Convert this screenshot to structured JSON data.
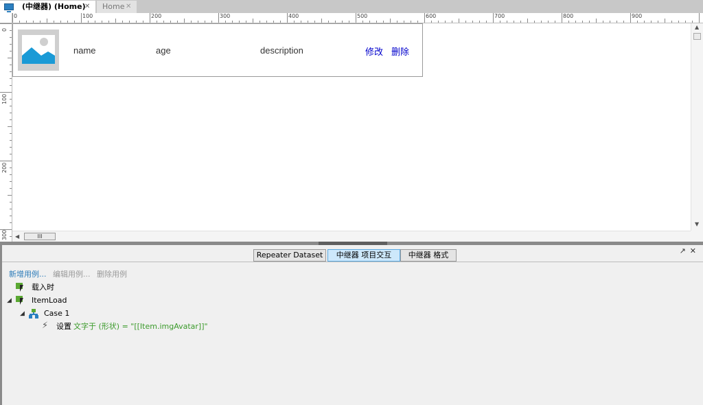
{
  "tabs": [
    {
      "label": "(中继器) (Home)",
      "close": "✕"
    },
    {
      "label": "Home",
      "close": "✕"
    }
  ],
  "ruler": {
    "horizontal": [
      "0",
      "100",
      "200",
      "300",
      "400",
      "500",
      "600",
      "700",
      "800",
      "900"
    ],
    "vertical": [
      "0",
      "100",
      "200",
      "300"
    ]
  },
  "repeater": {
    "columns": [
      "name",
      "age",
      "description"
    ],
    "edit_link": "修改",
    "delete_link": "删除"
  },
  "scrollbar": {
    "thumb_grip": "III"
  },
  "panel": {
    "tabs": [
      "Repeater Dataset",
      "中继器 项目交互",
      "中继器 格式"
    ],
    "active_tab": "中继器 项目交互",
    "controls": [
      "↗",
      "✕"
    ],
    "case_actions": {
      "add": "新增用例...",
      "edit": "编辑用例...",
      "delete": "删除用例"
    },
    "events": [
      {
        "label": "载入时"
      },
      {
        "label": "ItemLoad",
        "case": "Case 1",
        "action_prefix": "设置",
        "action_detail": "文字于 (形状) = \"[[Item.imgAvatar]]\""
      }
    ]
  },
  "colors": {
    "link": "#0000cc",
    "accent": "#2a7ab8",
    "action_green": "#3a9a2a",
    "active_tab": "#cde8fb"
  },
  "icons": [
    "tab-page-icon",
    "close-icon",
    "image-placeholder-icon",
    "event-icon",
    "case-icon",
    "lightning-action-icon",
    "expand-triangle-icon",
    "popout-icon"
  ]
}
